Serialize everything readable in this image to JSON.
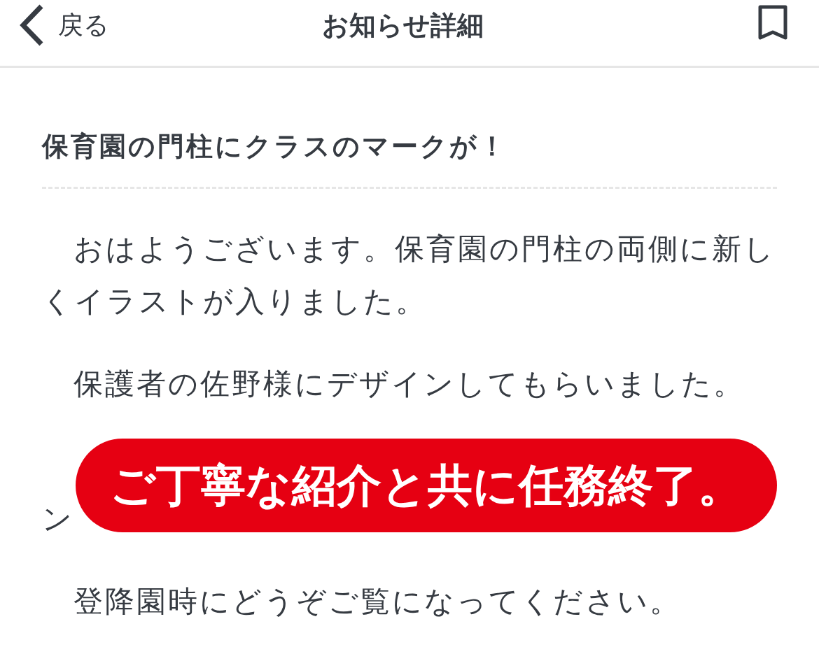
{
  "header": {
    "back_label": "戻る",
    "title": "お知らせ詳細"
  },
  "article": {
    "title": "保育園の門柱にクラスのマークが！",
    "paragraphs": [
      {
        "kind": "full",
        "text": "おはようございます。保育園の門柱の両側に新しくイラストが入りました。"
      },
      {
        "kind": "full",
        "text": "保護者の佐野様にデザインしてもらいました。"
      },
      {
        "kind": "covered",
        "text": "ン"
      },
      {
        "kind": "full",
        "text": "登降園時にどうぞご覧になってください。"
      }
    ]
  },
  "overlay_caption": "ご丁寧な紹介と共に任務終了。"
}
